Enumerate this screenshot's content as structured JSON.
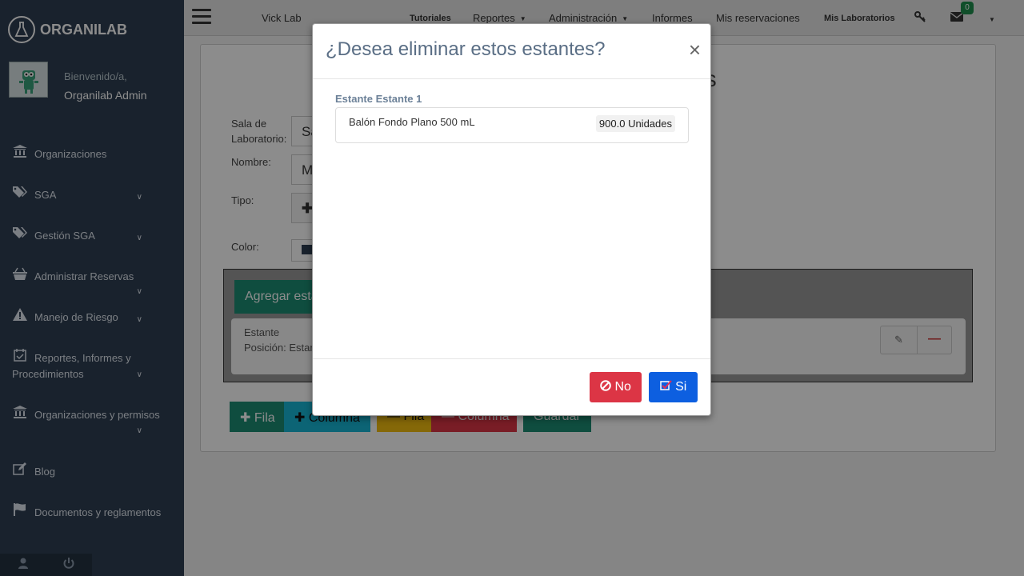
{
  "brand": {
    "name": "ORGANILAB"
  },
  "user": {
    "welcome": "Bienvenido/a,",
    "name": "Organilab Admin"
  },
  "sidebar": {
    "items": [
      {
        "label": "Organizaciones",
        "icon": "bank-icon"
      },
      {
        "label": "SGA",
        "icon": "tags-icon"
      },
      {
        "label": "Gestión SGA",
        "icon": "tags-icon"
      },
      {
        "label": "Administrar Reservas",
        "icon": "basket-icon"
      },
      {
        "label": "Manejo de Riesgo",
        "icon": "warning-icon"
      },
      {
        "label": "Reportes, Informes y Procedimientos",
        "icon": "calendar-check-icon"
      },
      {
        "label": "Organizaciones y permisos",
        "icon": "bank-icon"
      },
      {
        "label": "Blog",
        "icon": "edit-icon"
      },
      {
        "label": "Documentos y reglamentos",
        "icon": "flag-icon"
      }
    ]
  },
  "topbar": {
    "lab": "Vick Lab",
    "tutoriales": "Tutoriales",
    "reportes": "Reportes",
    "administracion": "Administración",
    "informes": "Informes",
    "reservaciones": "Mis reservaciones",
    "mis_laboratorios": "Mis Laboratorios",
    "mail_count": "0"
  },
  "form": {
    "title_fragment": "es",
    "sala_label": "Sala de Laboratorio:",
    "sala_value": "Sa",
    "nombre_label": "Nombre:",
    "nombre_value": "M",
    "tipo_label": "Tipo:",
    "color_label": "Color:",
    "add_shelf": "Agregar esta",
    "shelf_card_title": "Estante",
    "shelf_card_position": "Posición: Estar",
    "buttons": {
      "fila_add": "Fila",
      "columna_add": "Columna",
      "fila_remove": "Fila",
      "columna_remove": "Columna",
      "guardar": "Guardar"
    }
  },
  "modal": {
    "title": "¿Desea eliminar estos estantes?",
    "close": "×",
    "shelf_heading": "Estante Estante 1",
    "item_name": "Balón Fondo Plano 500 mL",
    "item_qty": "900.0 Unidades",
    "no_label": "No",
    "yes_label": "Si"
  },
  "colors": {
    "sidebar": "#2f3f52",
    "danger": "#dc3545",
    "primary": "#0d5fe0",
    "success": "#1c8c74"
  }
}
